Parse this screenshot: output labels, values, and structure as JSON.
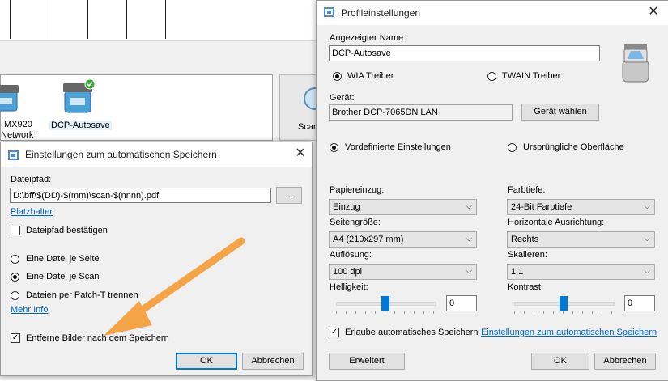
{
  "background": {
    "devices": [
      {
        "label_line1": "MX920",
        "label_line2": "Network"
      },
      {
        "label": "DCP-Autosave"
      }
    ],
    "scan_button_label": "Scan"
  },
  "autosave_dialog": {
    "title": "Einstellungen zum automatischen Speichern",
    "close_icon": "close-icon",
    "dateipfad_label": "Dateipfad:",
    "dateipfad_value": "D:\\bff\\$(DD)-$(mm)\\scan-$(nnnn).pdf",
    "browse_label": "...",
    "platzhalter_link": "Platzhalter",
    "confirm_path_label": "Dateipfad bestätigen",
    "confirm_path_checked": false,
    "radio_options": [
      "Eine Datei je Seite",
      "Eine Datei je Scan",
      "Dateien per Patch-T trennen"
    ],
    "radio_selected": 1,
    "mehr_info_link": "Mehr Info",
    "remove_images_label": "Entferne Bilder nach dem Speichern",
    "remove_images_checked": true,
    "ok_label": "OK",
    "cancel_label": "Abbrechen",
    "arrow_color": "#f5a347"
  },
  "profile_dialog": {
    "title": "Profileinstellungen",
    "name_label": "Angezeigter Name:",
    "name_value": "DCP-Autosave",
    "driver_options": [
      "WIA Treiber",
      "TWAIN Treiber"
    ],
    "driver_selected": 0,
    "device_label": "Gerät:",
    "device_value": "Brother DCP-7065DN LAN",
    "choose_device_label": "Gerät wählen",
    "mode_options": [
      "Vordefinierte Einstellungen",
      "Ursprüngliche Oberfläche"
    ],
    "mode_selected": 0,
    "papiereinzug_label": "Papiereinzug:",
    "papiereinzug_value": "Einzug",
    "farbtiefe_label": "Farbtiefe:",
    "farbtiefe_value": "24-Bit Farbtiefe",
    "seitengroesse_label": "Seitengröße:",
    "seitengroesse_value": "A4 (210x297 mm)",
    "ausrichtung_label": "Horizontale Ausrichtung:",
    "ausrichtung_value": "Rechts",
    "aufloesung_label": "Auflösung:",
    "aufloesung_value": "100 dpi",
    "skalieren_label": "Skalieren:",
    "skalieren_value": "1:1",
    "helligkeit_label": "Helligkeit:",
    "helligkeit_value": "0",
    "kontrast_label": "Kontrast:",
    "kontrast_value": "0",
    "autosave_label": "Erlaube automatisches Speichern",
    "autosave_checked": true,
    "autosave_link": "Einstellungen zum automatischen Speichern",
    "erweitert_label": "Erweitert",
    "ok_label": "OK",
    "cancel_label": "Abbrechen",
    "accent_color": "#0078d7"
  }
}
